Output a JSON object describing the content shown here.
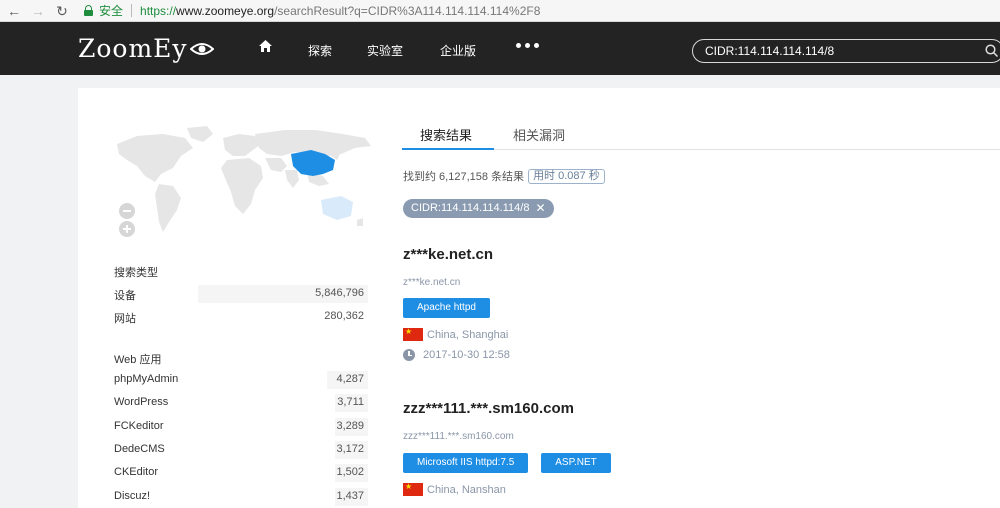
{
  "browser": {
    "secure_label": "安全",
    "url_scheme": "https://",
    "url_host": "www.zoomeye.org",
    "url_path": "/searchResult?q=CIDR%3A114.114.114.114%2F8"
  },
  "header": {
    "logo_text": "ZoomEy",
    "nav": [
      "探索",
      "实验室",
      "企业版"
    ],
    "search_value": "CIDR:114.114.114.114/8"
  },
  "tabs": {
    "active": "搜索结果",
    "inactive": "相关漏洞"
  },
  "stats": {
    "text": "找到约 6,127,158 条结果",
    "timing": "用时 0.087 秒"
  },
  "filter_chip": {
    "label": "CIDR:114.114.114.114/8",
    "close": "✕"
  },
  "sidebar": {
    "search_type_heading": "搜索类型",
    "search_types": [
      {
        "label": "设备",
        "count": "5,846,796",
        "ratio": 0.67
      },
      {
        "label": "网站",
        "count": "280,362",
        "ratio": 0.0
      }
    ],
    "web_apps_heading": "Web 应用",
    "web_apps": [
      {
        "label": "phpMyAdmin",
        "count": "4,287",
        "ratio": 0.16
      },
      {
        "label": "WordPress",
        "count": "3,711",
        "ratio": 0.13
      },
      {
        "label": "FCKeditor",
        "count": "3,289",
        "ratio": 0.13
      },
      {
        "label": "DedeCMS",
        "count": "3,172",
        "ratio": 0.13
      },
      {
        "label": "CKEditor",
        "count": "1,502",
        "ratio": 0.13
      },
      {
        "label": "Discuz!",
        "count": "1,437",
        "ratio": 0.13
      }
    ]
  },
  "results": [
    {
      "title": "z***ke.net.cn",
      "subtitle": "z***ke.net.cn",
      "badges": [
        "Apache httpd"
      ],
      "location": "China, Shanghai",
      "timestamp": "2017-10-30 12:58"
    },
    {
      "title": "zzz***111.***.sm160.com",
      "subtitle": "zzz***111.***.sm160.com",
      "badges": [
        "Microsoft IIS httpd:7.5",
        "ASP.NET"
      ],
      "location": "China, Nanshan"
    }
  ],
  "colors": {
    "accent": "#1e8ee5",
    "header_bg": "#232323",
    "chip_bg": "#8a9bb1",
    "map_highlight": "#1e8ee5"
  }
}
